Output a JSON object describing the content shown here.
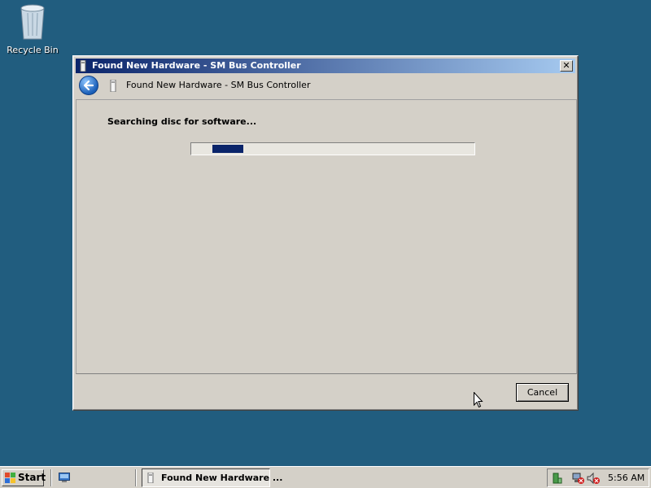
{
  "desktop": {
    "recycle_bin_label": "Recycle Bin"
  },
  "dialog": {
    "window_title": "Found New Hardware - SM Bus Controller",
    "header_title": "Found New Hardware - SM Bus Controller",
    "close_glyph": "✕",
    "status_text": "Searching disc for software...",
    "progress": {
      "state": "indeterminate (marquee)",
      "block_start_fraction": 0.075,
      "block_width_fraction": 0.11
    },
    "cancel_label": "Cancel"
  },
  "taskbar": {
    "start_label": "Start",
    "task_button_label": "Found New Hardware ...",
    "clock": "5:56 AM"
  },
  "icons": {
    "recycle_bin": "recycle-bin-icon",
    "back": "back-arrow-icon",
    "hardware": "hardware-icon",
    "windows_logo": "windows-logo-icon",
    "show_desktop": "show-desktop-icon",
    "tray": [
      "network-icon",
      "network-disconnected-icon",
      "volume-muted-icon"
    ]
  },
  "colors": {
    "desktop": "#215d7f",
    "title_start": "#0a246a",
    "title_end": "#a6caf0",
    "progress_fill": "#0a246a",
    "face": "#d4d0c8"
  }
}
